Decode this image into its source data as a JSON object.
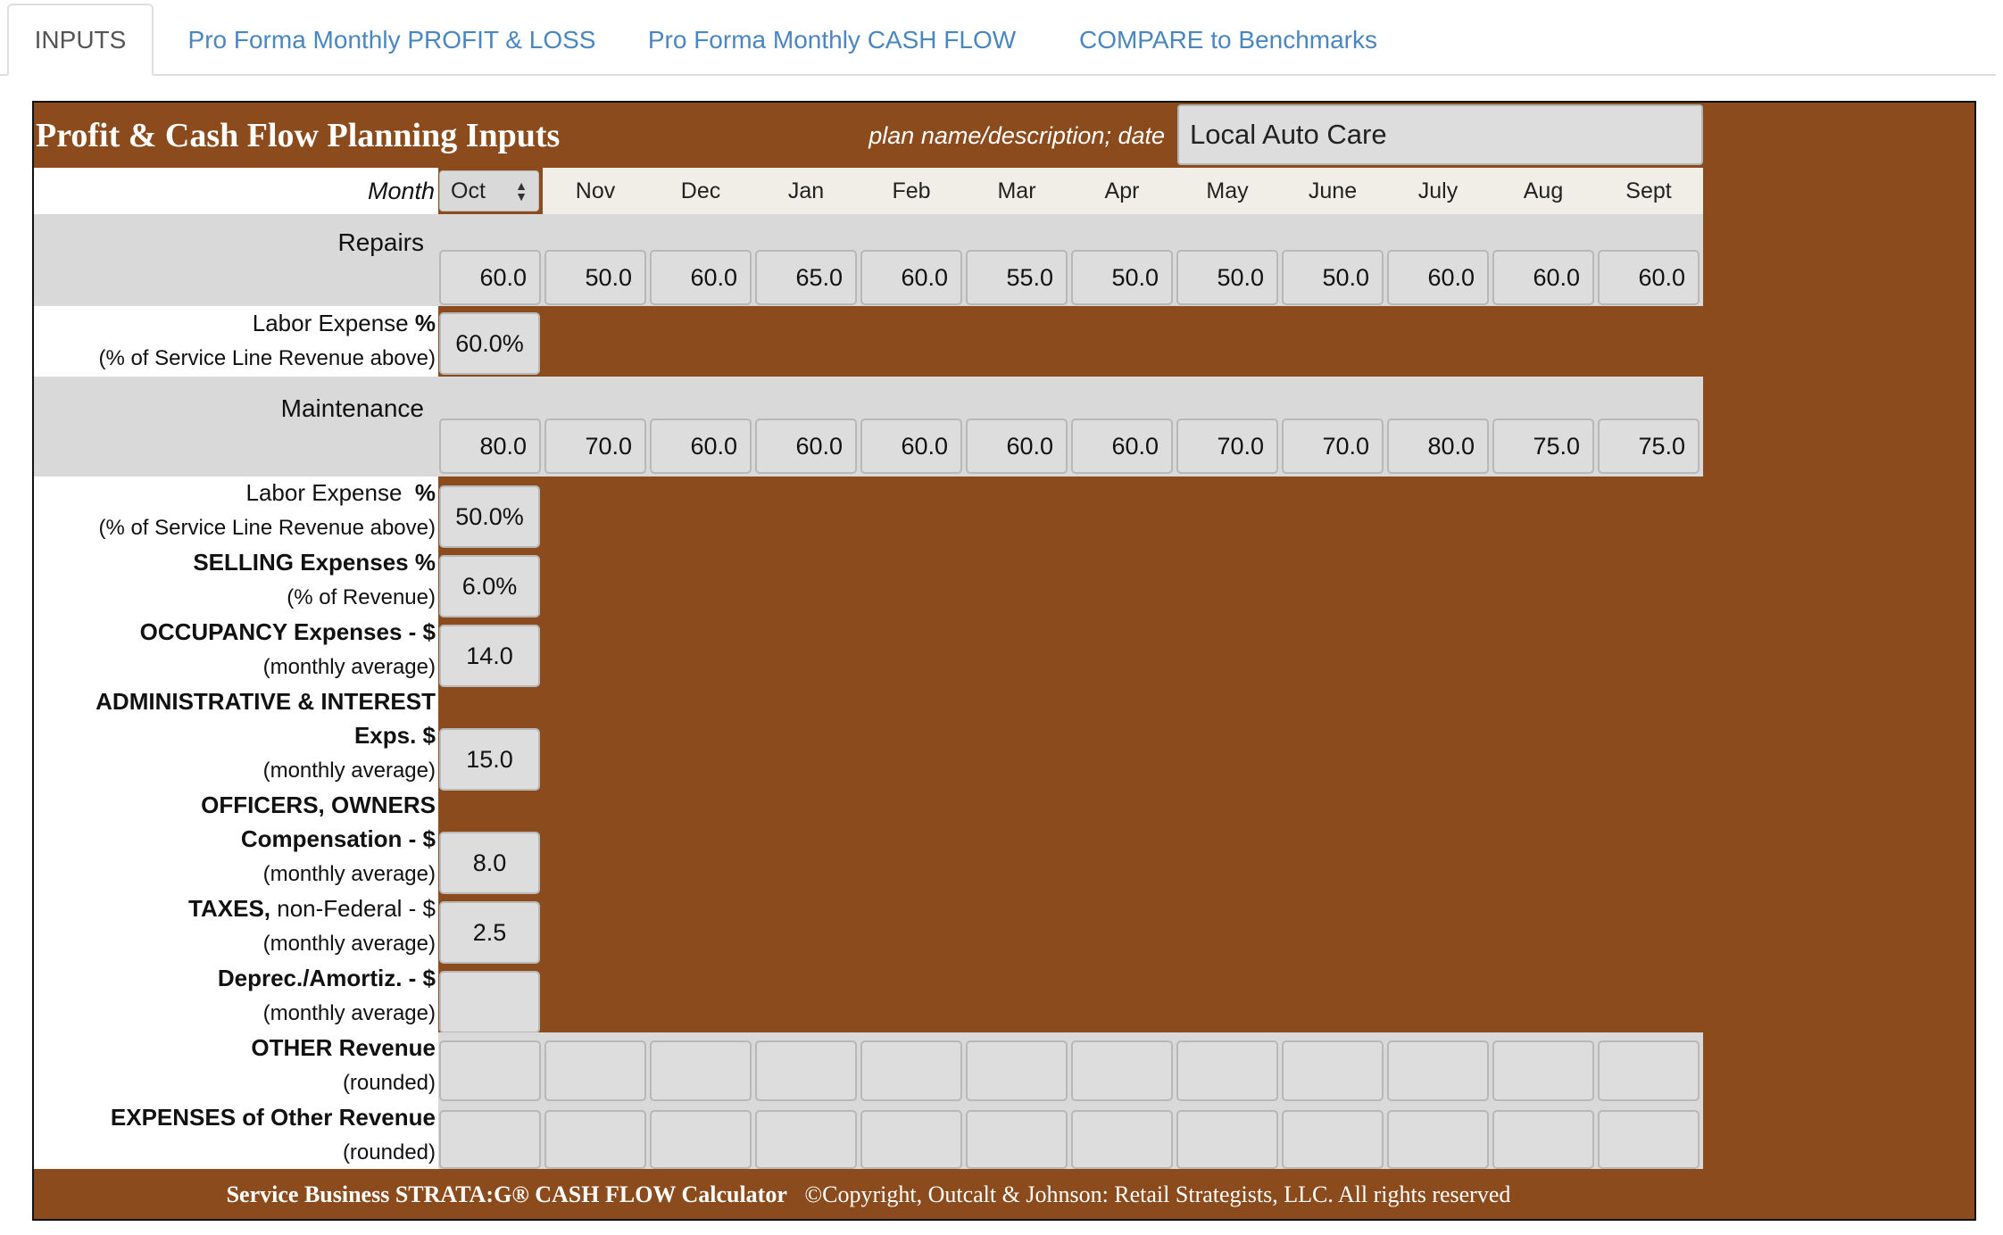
{
  "tabs": [
    {
      "label": "INPUTS"
    },
    {
      "label": "Pro Forma Monthly PROFIT & LOSS"
    },
    {
      "label": "Pro Forma Monthly CASH FLOW"
    },
    {
      "label": "COMPARE to Benchmarks"
    }
  ],
  "header": {
    "title": "Profit & Cash Flow Planning Inputs",
    "plan_label": "plan name/description; date",
    "plan_value": "Local Auto Care"
  },
  "month_row": {
    "label": "Month",
    "selected": "Oct",
    "months": [
      "Nov",
      "Dec",
      "Jan",
      "Feb",
      "Mar",
      "Apr",
      "May",
      "June",
      "July",
      "Aug",
      "Sept"
    ]
  },
  "repairs": {
    "label": "Repairs",
    "values": [
      "60.0",
      "50.0",
      "60.0",
      "65.0",
      "60.0",
      "55.0",
      "50.0",
      "50.0",
      "50.0",
      "60.0",
      "60.0",
      "60.0"
    ],
    "labor_label": "Labor Expense",
    "labor_pct_symbol": "%",
    "labor_sub": "(% of Service Line Revenue above)",
    "labor_value": "60.0%"
  },
  "maintenance": {
    "label": "Maintenance",
    "values": [
      "80.0",
      "70.0",
      "60.0",
      "60.0",
      "60.0",
      "60.0",
      "60.0",
      "70.0",
      "70.0",
      "80.0",
      "75.0",
      "75.0"
    ],
    "labor_label": "Labor Expense",
    "labor_pct_symbol": "%",
    "labor_sub": "(% of Service Line Revenue above)",
    "labor_value": "50.0%"
  },
  "selling": {
    "label": "SELLING Expenses %",
    "sub": "(% of Revenue)",
    "value": "6.0%"
  },
  "occupancy": {
    "label": "OCCUPANCY Expenses - $",
    "sub": "(monthly average)",
    "value": "14.0"
  },
  "admin": {
    "label1": "ADMINISTRATIVE & INTEREST",
    "label2": "Exps. $",
    "sub": "(monthly average)",
    "value": "15.0"
  },
  "officers": {
    "label1": "OFFICERS, OWNERS",
    "label2": "Compensation - $",
    "sub": "(monthly average)",
    "value": "8.0"
  },
  "taxes": {
    "label_bold": "TAXES,",
    "label_rest": " non-Federal - $",
    "sub": "(monthly average)",
    "value": "2.5"
  },
  "deprec": {
    "label": "Deprec./Amortiz. - $",
    "sub": "(monthly average)",
    "value": ""
  },
  "other_revenue": {
    "label": "OTHER Revenue",
    "sub": "(rounded)",
    "values": [
      "",
      "",
      "",
      "",
      "",
      "",
      "",
      "",
      "",
      "",
      "",
      ""
    ]
  },
  "other_expenses": {
    "label": "EXPENSES of Other Revenue",
    "sub": "(rounded)",
    "values": [
      "",
      "",
      "",
      "",
      "",
      "",
      "",
      "",
      "",
      "",
      "",
      ""
    ]
  },
  "footer": {
    "product": "Service Business STRATA:G® CASH FLOW Calculator",
    "copyright": "©Copyright, Outcalt & Johnson: Retail Strategists, LLC.  All rights reserved"
  },
  "colors": {
    "brand": "#8b4b1c",
    "input_bg": "#dddddd",
    "tab_link": "#4a86c0"
  }
}
